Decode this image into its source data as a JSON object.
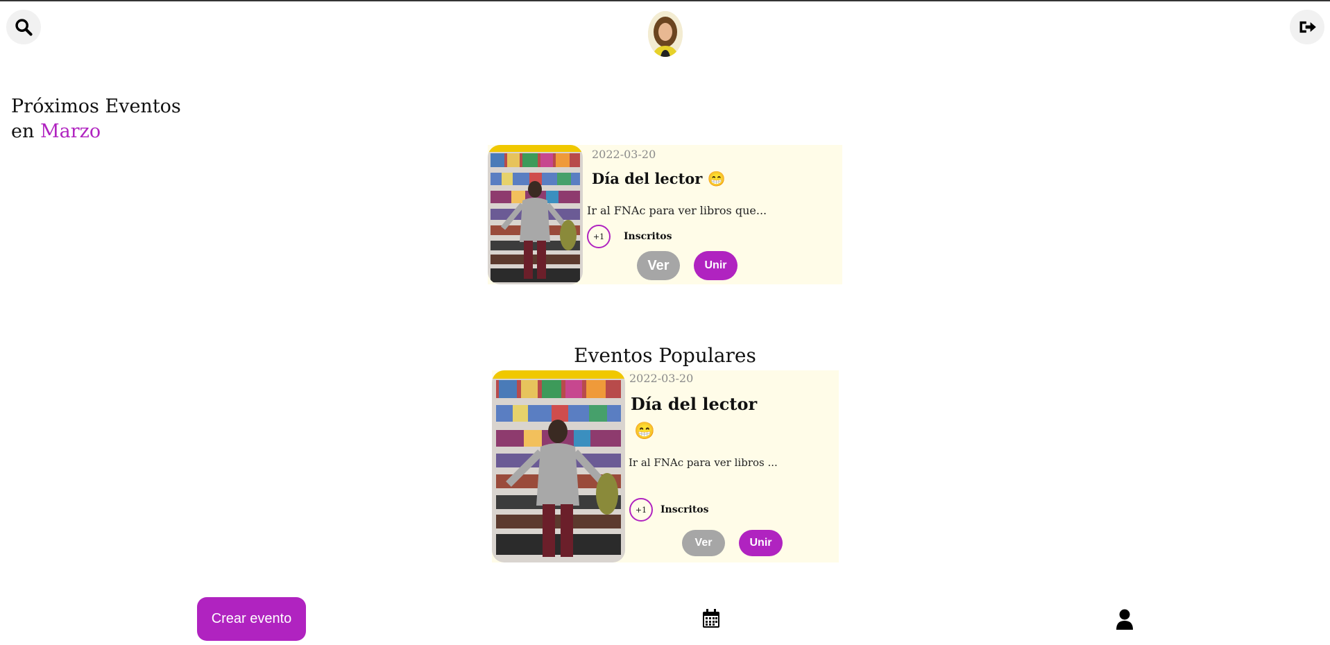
{
  "header": {
    "search_icon": "search-icon",
    "logout_icon": "sign-out-icon",
    "avatar": "user-avatar"
  },
  "upcoming": {
    "title_line1": "Próximos Eventos",
    "title_line2_prefix": "en",
    "month": "Marzo",
    "card": {
      "date": "2022-03-20",
      "title": "Día del lector 😁",
      "description": "Ir al FNAc para ver libros que...",
      "count": "+1",
      "count_label": "Inscritos",
      "view_label": "Ver",
      "join_label": "Unir"
    }
  },
  "popular": {
    "title": "Eventos Populares",
    "card": {
      "date": "2022-03-20",
      "title": "Día del lector",
      "title_emoji": "😁",
      "description": "Ir al FNAc para ver libros ...",
      "count": "+1",
      "count_label": "Inscritos",
      "view_label": "Ver",
      "join_label": "Unir"
    }
  },
  "bottom_nav": {
    "create_label": "Crear evento",
    "calendar_icon": "calendar-icon",
    "profile_icon": "user-icon"
  },
  "colors": {
    "accent": "#b023c0",
    "card_bg": "#fffce8",
    "secondary_button": "#a6a6a6"
  }
}
